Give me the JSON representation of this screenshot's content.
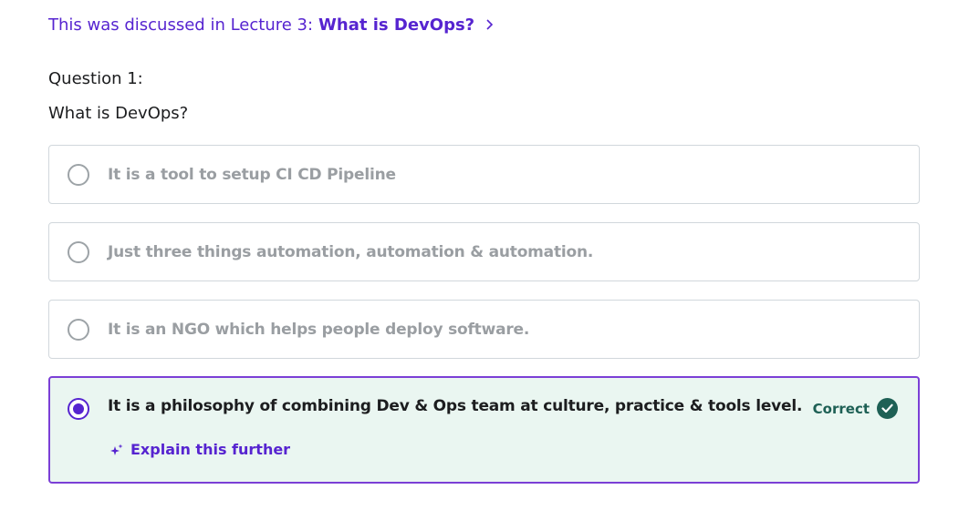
{
  "lecture_link": {
    "prefix": "This was discussed in Lecture 3:",
    "title": "What is DevOps?",
    "icon": "chevron-right-icon"
  },
  "question": {
    "number_label": "Question 1:",
    "text": "What is DevOps?"
  },
  "answers": [
    {
      "label": "It is a tool to setup CI CD Pipeline",
      "selected": false
    },
    {
      "label": "Just three things automation, automation & automation.",
      "selected": false
    },
    {
      "label": "It is an NGO which helps people deploy software.",
      "selected": false
    },
    {
      "label": "It is a philosophy of combining Dev & Ops team at culture, practice & tools level.",
      "selected": true,
      "result": "Correct"
    }
  ],
  "explain": {
    "label": "Explain this further",
    "icon": "sparkle-icon"
  },
  "colors": {
    "accent": "#5624d0",
    "correct_green": "#1e6055",
    "correct_bg": "#eaf6f1",
    "selected_border": "#7b3fd6"
  }
}
